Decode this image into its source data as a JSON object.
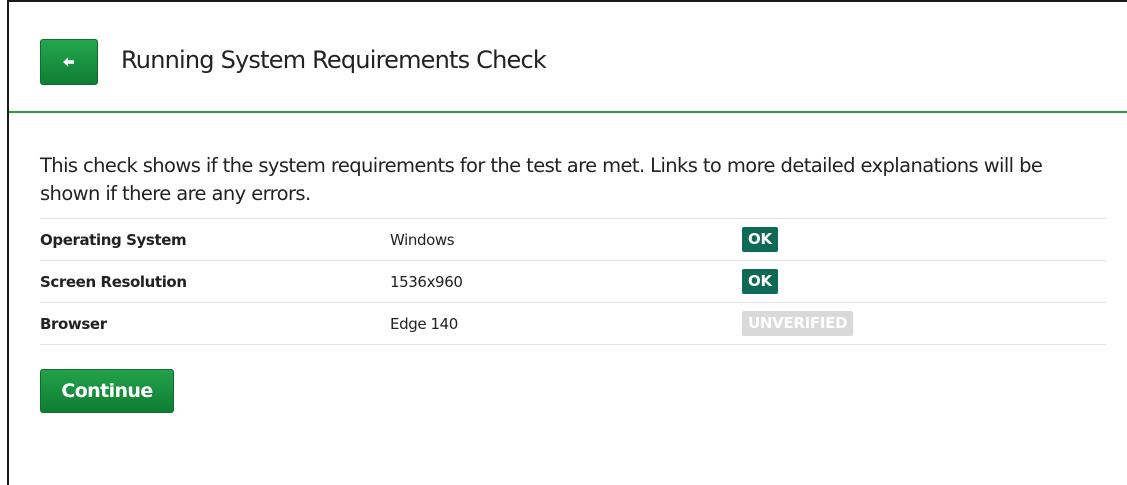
{
  "header": {
    "title": "Running System Requirements Check",
    "back_icon": "arrow-left-icon"
  },
  "intro_text": "This check shows if the system requirements for the test are met. Links to more detailed explanations will be shown if there are any errors.",
  "requirements": [
    {
      "label": "Operating System",
      "value": "Windows",
      "status": "OK"
    },
    {
      "label": "Screen Resolution",
      "value": "1536x960",
      "status": "OK"
    },
    {
      "label": "Browser",
      "value": "Edge 140",
      "status": "UNVERIFIED"
    }
  ],
  "continue_label": "Continue",
  "colors": {
    "accent_green": "#1a9340",
    "ok_badge": "#0f6a55",
    "unverified_badge": "#d9d9d9",
    "divider": "#23a24a"
  }
}
